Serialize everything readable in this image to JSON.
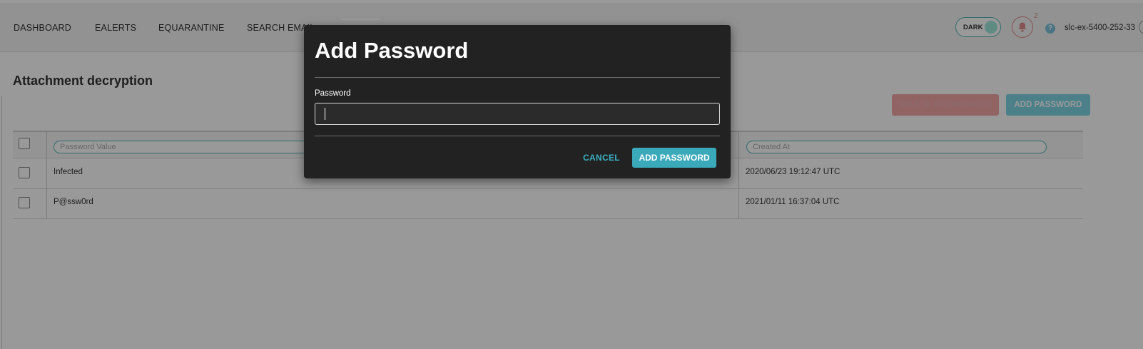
{
  "nav": {
    "items": [
      "DASHBOARD",
      "EALERTS",
      "EQUARANTINE",
      "SEARCH EMAIL"
    ]
  },
  "header": {
    "theme_toggle_label": "DARK",
    "notification_count": "2",
    "help_label": "?",
    "hostname": "slc-ex-5400-252-33"
  },
  "page": {
    "title": "Attachment decryption",
    "delete_button": "DELETE PASSWORD(S)",
    "add_button": "ADD PASSWORD"
  },
  "table": {
    "filters": {
      "password_placeholder": "Password Value",
      "created_placeholder": "Created At"
    },
    "rows": [
      {
        "password": "Infected",
        "created_at": "2020/06/23 19:12:47 UTC"
      },
      {
        "password": "P@ssw0rd",
        "created_at": "2021/01/11 16:37:04 UTC"
      }
    ]
  },
  "modal": {
    "title": "Add Password",
    "field_label": "Password",
    "field_value": "",
    "cancel_label": "CANCEL",
    "submit_label": "ADD PASSWORD"
  },
  "colors": {
    "accent": "#3aa9ba",
    "danger": "#f3a5a5",
    "modal_bg": "#222222"
  }
}
